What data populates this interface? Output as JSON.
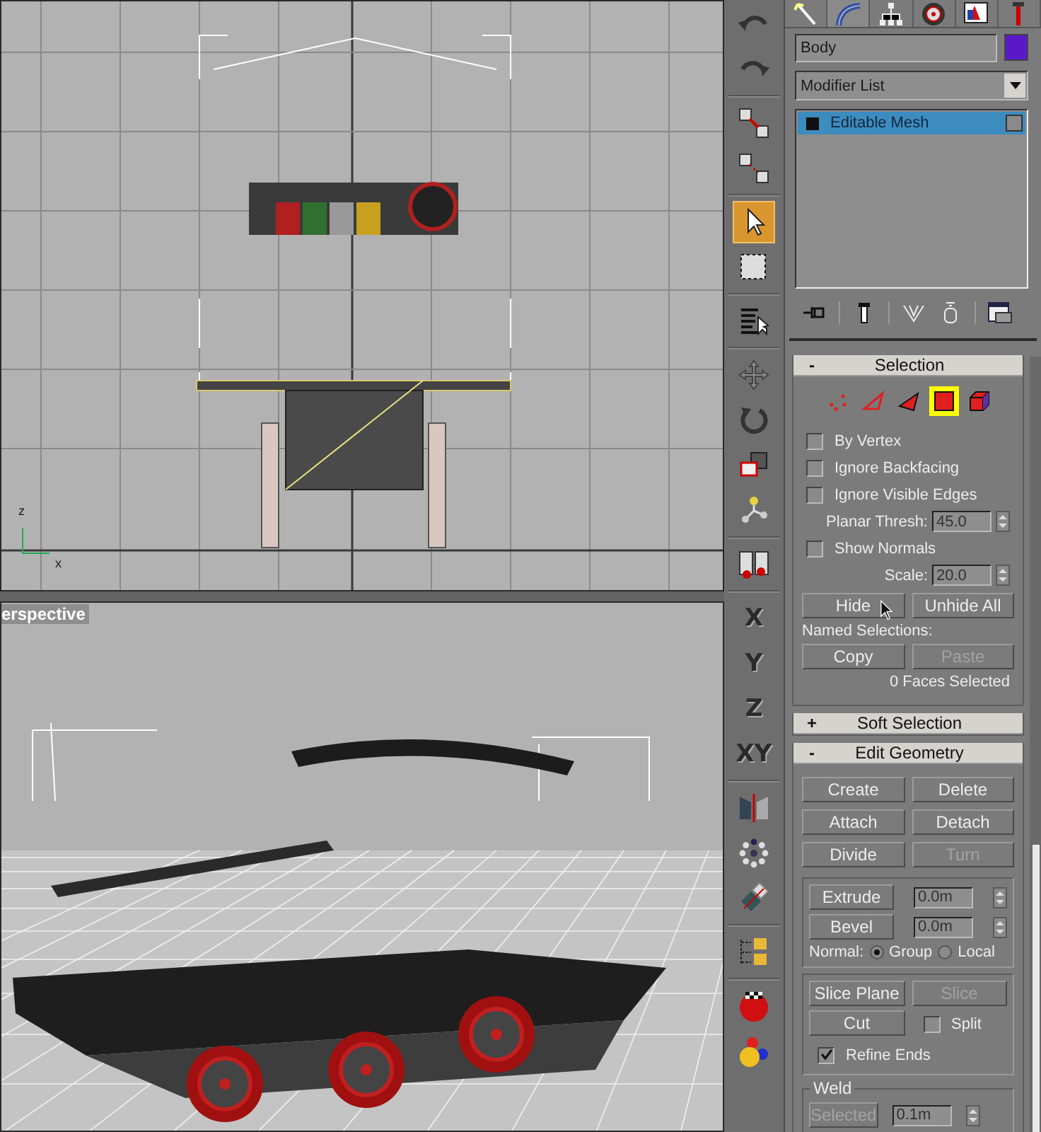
{
  "viewports": {
    "front": {
      "axis_labels": [
        "z",
        "x"
      ]
    },
    "perspective": {
      "label": "erspective"
    }
  },
  "toolbar": [
    {
      "kind": "undo",
      "selected": false
    },
    {
      "kind": "redo",
      "selected": false
    },
    {
      "kind": "sep"
    },
    {
      "kind": "link",
      "selected": false
    },
    {
      "kind": "unlink",
      "selected": false
    },
    {
      "kind": "sep"
    },
    {
      "kind": "select",
      "selected": true
    },
    {
      "kind": "region",
      "selected": false
    },
    {
      "kind": "sep"
    },
    {
      "kind": "select-list",
      "selected": false
    },
    {
      "kind": "sep"
    },
    {
      "kind": "move",
      "selected": false
    },
    {
      "kind": "rotate",
      "selected": false
    },
    {
      "kind": "scale",
      "selected": false
    },
    {
      "kind": "manipulate",
      "selected": false
    },
    {
      "kind": "sep"
    },
    {
      "kind": "snap",
      "selected": false
    },
    {
      "kind": "sep"
    },
    {
      "kind": "axis",
      "label": "X",
      "selected": false
    },
    {
      "kind": "axis",
      "label": "Y",
      "selected": false
    },
    {
      "kind": "axis",
      "label": "Z",
      "selected": false
    },
    {
      "kind": "axis",
      "label": "XY",
      "selected": false
    },
    {
      "kind": "sep"
    },
    {
      "kind": "mirror",
      "selected": false
    },
    {
      "kind": "array",
      "selected": false
    },
    {
      "kind": "align",
      "selected": false
    },
    {
      "kind": "sep"
    },
    {
      "kind": "layers",
      "selected": false
    },
    {
      "kind": "sep"
    },
    {
      "kind": "material",
      "selected": false
    },
    {
      "kind": "render",
      "selected": false
    }
  ],
  "command_panel": {
    "tabs": [
      {
        "kind": "create",
        "selected": false
      },
      {
        "kind": "modify",
        "selected": true
      },
      {
        "kind": "hierarchy",
        "selected": false
      },
      {
        "kind": "motion",
        "selected": false
      },
      {
        "kind": "display",
        "selected": false
      },
      {
        "kind": "utilities",
        "selected": false
      }
    ],
    "object_name": "Body",
    "modifier_list": "Modifier List",
    "stack": [
      {
        "label": "Editable Mesh",
        "selected": true
      }
    ],
    "stack_tools": [
      {
        "kind": "pin"
      },
      {
        "kind": "sep"
      },
      {
        "kind": "show-end"
      },
      {
        "kind": "sep"
      },
      {
        "kind": "unique"
      },
      {
        "kind": "remove"
      },
      {
        "kind": "sep"
      },
      {
        "kind": "configure"
      }
    ],
    "selection_rollout": {
      "toggle": "-",
      "title": "Selection",
      "expanded": true,
      "subobject_levels": [
        {
          "kind": "vertex",
          "selected": false
        },
        {
          "kind": "edge",
          "selected": false
        },
        {
          "kind": "face",
          "selected": false
        },
        {
          "kind": "polygon",
          "selected": true
        },
        {
          "kind": "element",
          "selected": false
        }
      ],
      "options": [
        {
          "label": "By Vertex",
          "checked": false
        },
        {
          "label": "Ignore Backfacing",
          "checked": false
        },
        {
          "label": "Ignore Visible Edges",
          "checked": false
        }
      ],
      "planar_thresh": {
        "label": "Planar Thresh:",
        "value": "45.0"
      },
      "show_normals": {
        "label": "Show Normals",
        "checked": false
      },
      "scale": {
        "label": "Scale:",
        "value": "20.0"
      },
      "buttons": [
        {
          "label": "Hide",
          "disabled": false
        },
        {
          "label": "Unhide All",
          "disabled": false
        }
      ],
      "named_selections_label": "Named Selections:",
      "named_buttons": [
        {
          "label": "Copy",
          "disabled": false
        },
        {
          "label": "Paste",
          "disabled": true
        }
      ],
      "status": "0 Faces Selected"
    },
    "soft_selection_rollout": {
      "toggle": "+",
      "title": "Soft Selection",
      "expanded": false
    },
    "edit_geometry_rollout": {
      "toggle": "-",
      "title": "Edit Geometry",
      "expanded": true,
      "buttons": [
        {
          "label": "Create",
          "disabled": false
        },
        {
          "label": "Delete",
          "disabled": false
        },
        {
          "label": "Attach",
          "disabled": false
        },
        {
          "label": "Detach",
          "disabled": false
        },
        {
          "label": "Divide",
          "disabled": false
        },
        {
          "label": "Turn",
          "disabled": true
        }
      ],
      "extrude": {
        "label": "Extrude",
        "value": "0.0m"
      },
      "bevel": {
        "label": "Bevel",
        "value": "0.0m"
      },
      "normal": {
        "label": "Normal:",
        "options": [
          {
            "label": "Group",
            "selected": true
          },
          {
            "label": "Local",
            "selected": false
          }
        ]
      },
      "slice_buttons": [
        {
          "label": "Slice Plane",
          "disabled": false
        },
        {
          "label": "Slice",
          "disabled": true
        }
      ],
      "cut": {
        "label": "Cut",
        "disabled": false
      },
      "split": {
        "label": "Split",
        "checked": false
      },
      "refine_ends": {
        "label": "Refine Ends",
        "checked": true
      },
      "weld": {
        "title": "Weld",
        "button": {
          "label": "Selected",
          "disabled": true
        },
        "value": "0.1m"
      }
    }
  }
}
